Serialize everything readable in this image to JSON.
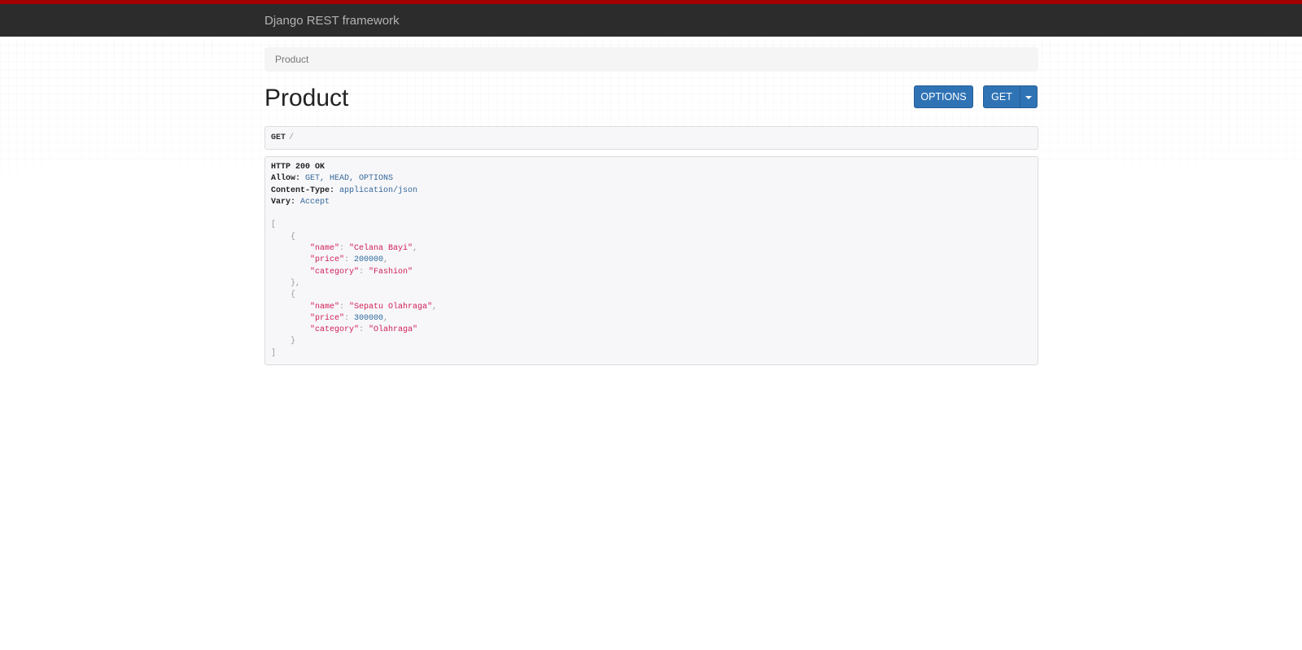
{
  "navbar": {
    "brand": "Django REST framework"
  },
  "breadcrumb": {
    "current": "Product"
  },
  "page": {
    "title": "Product"
  },
  "buttons": {
    "options_label": "OPTIONS",
    "get_label": "GET"
  },
  "request": {
    "method": "GET",
    "path": "/"
  },
  "response": {
    "status": "HTTP 200 OK",
    "headers": [
      {
        "key": "Allow:",
        "value": "GET, HEAD, OPTIONS"
      },
      {
        "key": "Content-Type:",
        "value": "application/json"
      },
      {
        "key": "Vary:",
        "value": "Accept"
      }
    ],
    "items": [
      {
        "name": "\"Celana Bayi\"",
        "price": "200000",
        "category": "\"Fashion\""
      },
      {
        "name": "\"Sepatu Olahraga\"",
        "price": "300000",
        "category": "\"Olahraga\""
      }
    ],
    "keys": {
      "name": "\"name\"",
      "price": "\"price\"",
      "category": "\"category\""
    }
  },
  "colors": {
    "navbar_bg": "#2c2c2c",
    "navbar_accent": "#a30000",
    "button_primary": "#2f73b5",
    "json_string": "#d01d55",
    "json_number": "#2e6a9e"
  }
}
